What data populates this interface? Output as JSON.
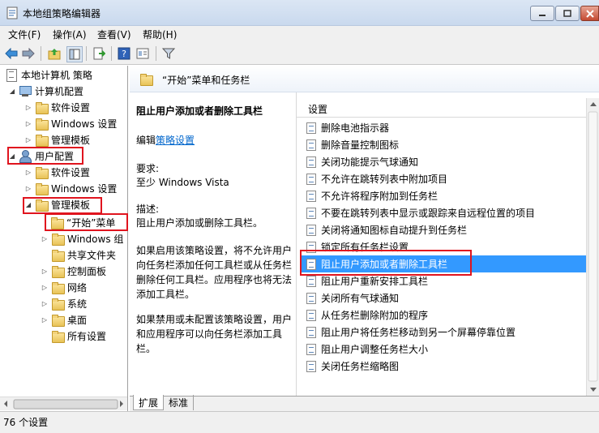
{
  "window": {
    "title": "本地组策略编辑器"
  },
  "menu": {
    "file": "文件(F)",
    "action": "操作(A)",
    "view": "查看(V)",
    "help": "帮助(H)"
  },
  "tree": {
    "root": "本地计算机 策略",
    "computer_config": "计算机配置",
    "cc_software": "软件设置",
    "cc_windows": "Windows 设置",
    "cc_admin": "管理模板",
    "user_config": "用户配置",
    "uc_software": "软件设置",
    "uc_windows": "Windows 设置",
    "uc_admin": "管理模板",
    "start_taskbar": "“开始”菜单",
    "windows_components": "Windows 组",
    "shared_folders": "共享文件夹",
    "control_panel": "控制面板",
    "network": "网络",
    "system": "系统",
    "desktop": "桌面",
    "all_settings": "所有设置"
  },
  "right": {
    "header_title": "“开始”菜单和任务栏",
    "desc_title": "阻止用户添加或者删除工具栏",
    "edit_prefix": "编辑",
    "edit_link": "策略设置",
    "requirements_label": "要求:",
    "requirements_value": "至少 Windows Vista",
    "description_label": "描述:",
    "description_value": "阻止用户添加或删除工具栏。",
    "desc_p1": [
      "如果启用该策略设置，将不允许用户",
      "向任务栏添加任何工具栏或从任务栏",
      "删除任何工具栏。应用程序也将无法",
      "添加工具栏。"
    ],
    "desc_p2": [
      "如果禁用或未配置该策略设置，用户",
      "和应用程序可以向任务栏添加工具",
      "栏。"
    ],
    "settings_header": "设置",
    "settings": [
      "删除电池指示器",
      "删除音量控制图标",
      "关闭功能提示气球通知",
      "不允许在跳转列表中附加项目",
      "不允许将程序附加到任务栏",
      "不要在跳转列表中显示或跟踪来自远程位置的项目",
      "关闭将通知图标自动提升到任务栏",
      "锁定所有任务栏设置",
      "阻止用户添加或者删除工具栏",
      "阻止用户重新安排工具栏",
      "关闭所有气球通知",
      "从任务栏删除附加的程序",
      "阻止用户将任务栏移动到另一个屏幕停靠位置",
      "阻止用户调整任务栏大小",
      "关闭任务栏缩略图"
    ]
  },
  "tabs": {
    "extended": "扩展",
    "standard": "标准"
  },
  "status": {
    "text": "76 个设置"
  },
  "colors": {
    "highlight": "#e0141e",
    "selection": "#3399ff",
    "link": "#0066cc"
  }
}
